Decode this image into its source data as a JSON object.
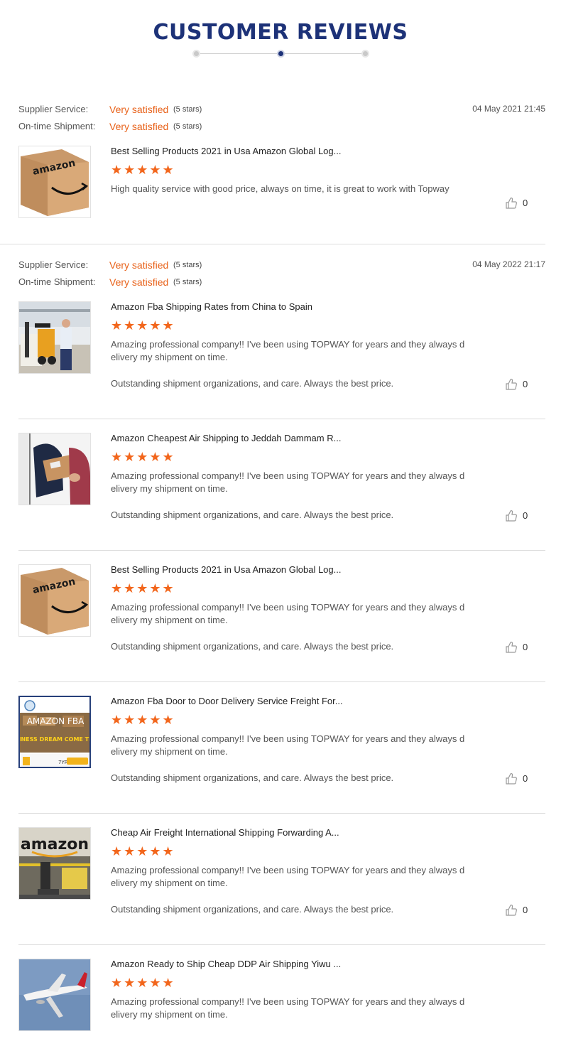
{
  "header": {
    "title": "CUSTOMER REVIEWS"
  },
  "reviews": [
    {
      "supplier_label": "Supplier Service:",
      "supplier_value": "Very satisfied",
      "supplier_stars": "(5 stars)",
      "shipment_label": "On-time Shipment:",
      "shipment_value": "Very satisfied",
      "shipment_stars": "(5 stars)",
      "date": "04 May 2021 21:45"
    },
    {
      "supplier_label": "Supplier Service:",
      "supplier_value": "Very satisfied",
      "supplier_stars": "(5 stars)",
      "shipment_label": "On-time Shipment:",
      "shipment_value": "Very satisfied",
      "shipment_stars": "(5 stars)",
      "date": "04 May 2022 21:17"
    }
  ],
  "items": [
    {
      "title": "Best Selling Products 2021 in Usa Amazon Global Log...",
      "rating": "★★★★★",
      "text": "High quality service with good price, always on time, it is great to work with Topway",
      "extra": "",
      "likes": "0",
      "thumb": "amazon-box"
    },
    {
      "title": "Amazon Fba Shipping Rates from China to Spain",
      "rating": "★★★★★",
      "text": "Amazing professional company!! I've been using TOPWAY for years and they always delivery my shipment on time.",
      "extra": "Outstanding shipment organizations, and care. Always the best price.",
      "likes": "0",
      "thumb": "warehouse"
    },
    {
      "title": "Amazon Cheapest Air Shipping to Jeddah Dammam R...",
      "rating": "★★★★★",
      "text": "Amazing professional company!! I've been using TOPWAY for years and they always delivery my shipment on time.",
      "extra": "Outstanding shipment organizations, and care. Always the best price.",
      "likes": "0",
      "thumb": "delivery"
    },
    {
      "title": "Best Selling Products 2021 in Usa Amazon Global Log...",
      "rating": "★★★★★",
      "text": "Amazing professional company!! I've been using TOPWAY for years and they always delivery my shipment on time.",
      "extra": "Outstanding shipment organizations, and care. Always the best price.",
      "likes": "0",
      "thumb": "amazon-box"
    },
    {
      "title": "Amazon Fba Door to Door Delivery Service Freight For...",
      "rating": "★★★★★",
      "text": "Amazing professional company!! I've been using TOPWAY for years and they always delivery my shipment on time.",
      "extra": "Outstanding shipment organizations, and care. Always the best price.",
      "likes": "0",
      "thumb": "fba-banner",
      "thumb_text": {
        "banner": "AMAZON FBA",
        "tagline": "BUSINESS DREAM COME TRUE?",
        "years": "7YR"
      }
    },
    {
      "title": "Cheap Air Freight International Shipping Forwarding A...",
      "rating": "★★★★★",
      "text": "Amazing professional company!! I've been using TOPWAY for years and they always delivery my shipment on time.",
      "extra": "Outstanding shipment organizations, and care. Always the best price.",
      "likes": "0",
      "thumb": "amazon-warehouse",
      "thumb_text": {
        "sign": "amazon"
      }
    },
    {
      "title": "Amazon Ready to Ship Cheap DDP Air Shipping Yiwu ...",
      "rating": "★★★★★",
      "text": "Amazing professional company!! I've been using TOPWAY for years and they always delivery my shipment on time.",
      "extra": "",
      "likes": "",
      "thumb": "airplane"
    }
  ],
  "colors": {
    "title": "#1d3278",
    "accent": "#e8621a",
    "star": "#f2661c"
  }
}
